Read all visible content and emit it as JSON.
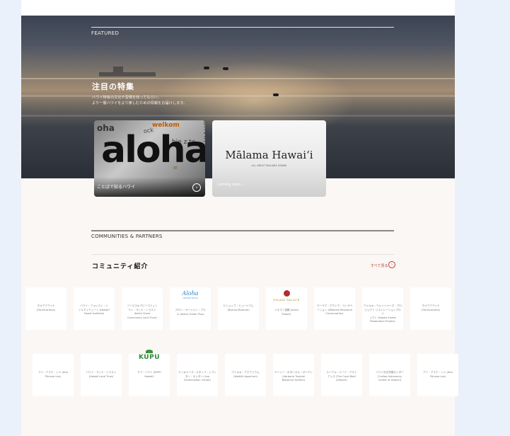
{
  "featured": {
    "label": "FEATURED",
    "title": "注目の特集",
    "desc_line1": "ハワイ特有の文化や習慣を知ってもらい、",
    "desc_line2": "より一層ハワイをより楽しむための情報をお届けします。"
  },
  "cards": [
    {
      "caption": "ことばで知るハワイ",
      "image_words": {
        "big": "aloha",
        "a": "oha",
        "b": "welkom",
        "c": "hje z te",
        "d": "ock",
        "e": "bonvin",
        "f": "ಹ"
      }
    },
    {
      "title": "Mālama Hawaiʻi",
      "subtitle": "ALL ABOUT MALAMA HAWAII",
      "caption": "coming soon..."
    }
  ],
  "communities": {
    "label": "COMMUNITIES & PARTNERS",
    "title": "コミュニティ紹介",
    "see_all": "すべて見る",
    "row1": [
      {
        "name": "ホオアアアイナ\n(Ho'okua'aina)"
      },
      {
        "name": "ハワイ・フォレスト・イ\nンスティテュート (Hawai'i\nForest Institute)"
      },
      {
        "name": "ゾーエスキアビーコミュニ\nティ・ランド・トラスト\n(North Shore\nCommunity Land Trust)"
      },
      {
        "name": "アロハ・オーシャン・プラ\nス (Aloha Ocean Plus)",
        "logo": "aloha",
        "logo_text": "Aloha",
        "logo_sub": "OCEAN PLUS"
      },
      {
        "name": "ビショップ・ミュージアム\n(Bishop Museum)"
      },
      {
        "name": "イオラニ宮殿 (Iolani\nPalace)",
        "logo": "palace",
        "logo_text": "IOLANI PALACE"
      },
      {
        "name": "マーラマ・マウンウ・コンサベ\nーション (Malama Maunalua\nConservation)"
      },
      {
        "name": "ワイキキ・ウォッシャーズ・プロ\nジェクト リストレーションプロジ\nェクト (Kaaala Forest\nRestoration Project)"
      },
      {
        "name": "ホオアアアイナ\n(Ho'okua'aina)"
      }
    ],
    "row2": [
      {
        "name": "アハ・アマナ・シャ (Aha\nPūnana Leo)"
      },
      {
        "name": "ハワイ・ランド・トラスト\n(Hawaii Land Trust)"
      },
      {
        "name": "クプ・ハワイ (KUPU\nHawaii)",
        "logo": "kupu",
        "logo_text": "KUPU"
      },
      {
        "name": "クッキャーズ・スタッフ・シアン\nター・センター (Loa\nConservation Center)"
      },
      {
        "name": "ワイキキ・アクアリウム\n(Waikiki Aquarium)"
      },
      {
        "name": "ケーシー・ボタニカル・ガーデン\n(Harbarie Tropical\nBotanical Garden)"
      },
      {
        "name": "ルーアル・リーフ・アライ\nアンス (The Coral Reef\nAlliance)"
      },
      {
        "name": "ハワイ天文学習センター\n('Imiloa Astronomy\nCenter of Hawai'i)"
      },
      {
        "name": "アハ・アマナ・シャ (Aha\nPūnana Leo)"
      }
    ]
  },
  "colors": {
    "accent": "#c0392b",
    "hero_dark": "#2a2f37"
  }
}
